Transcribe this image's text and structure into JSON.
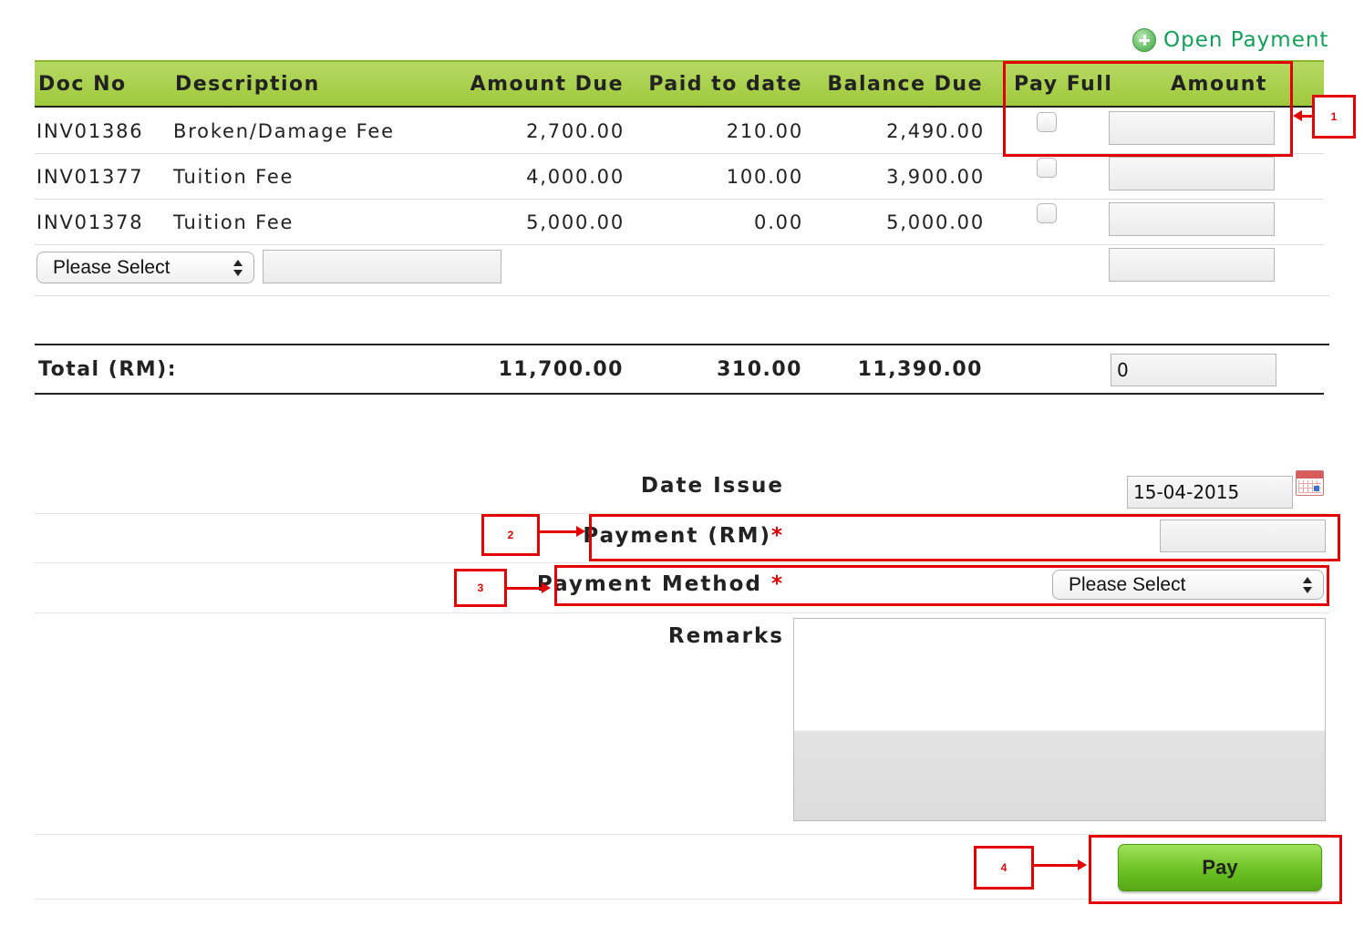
{
  "open_payment": {
    "label": "Open Payment",
    "icon": "plus-circle-icon"
  },
  "table": {
    "headers": [
      "Doc No",
      "Description",
      "Amount Due",
      "Paid to date",
      "Balance Due",
      "Pay Full",
      "Amount"
    ],
    "rows": [
      {
        "doc_no": "INV01386",
        "description": "Broken/Damage Fee",
        "amount_due": "2,700.00",
        "paid_to_date": "210.00",
        "balance_due": "2,490.00",
        "pay_full": false,
        "amount": ""
      },
      {
        "doc_no": "INV01377",
        "description": "Tuition Fee",
        "amount_due": "4,000.00",
        "paid_to_date": "100.00",
        "balance_due": "3,900.00",
        "pay_full": false,
        "amount": ""
      },
      {
        "doc_no": "INV01378",
        "description": "Tuition Fee",
        "amount_due": "5,000.00",
        "paid_to_date": "0.00",
        "balance_due": "5,000.00",
        "pay_full": false,
        "amount": ""
      }
    ],
    "extra_row": {
      "select_value": "Please Select",
      "description": "",
      "amount": ""
    },
    "total": {
      "label": "Total (RM):",
      "amount_due": "11,700.00",
      "paid_to_date": "310.00",
      "balance_due": "11,390.00",
      "amount": "0"
    }
  },
  "form": {
    "date_issue": {
      "label": "Date Issue",
      "value": "15-04-2015",
      "icon": "calendar-icon"
    },
    "payment": {
      "label": "Payment (RM)",
      "required_mark": "*",
      "value": ""
    },
    "payment_method": {
      "label": "Payment Method",
      "required_mark": "*",
      "value": "Please Select"
    },
    "remarks": {
      "label": "Remarks",
      "value": ""
    },
    "pay_button": {
      "label": "Pay"
    }
  },
  "annotations": [
    "1",
    "2",
    "3",
    "4"
  ],
  "colors": {
    "header_green": "#a8cf45",
    "link_green": "#12a05a",
    "annotation_red": "#e30000",
    "button_green": "#6cc224"
  }
}
